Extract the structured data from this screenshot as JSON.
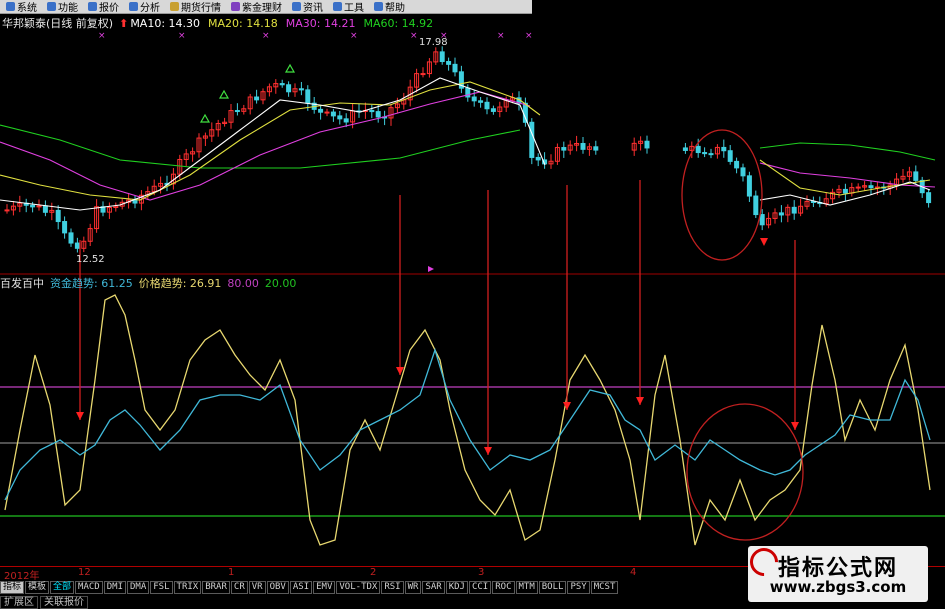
{
  "menu": {
    "items": [
      {
        "label": "系统",
        "color": "#3a70c8"
      },
      {
        "label": "功能",
        "color": "#3a70c8"
      },
      {
        "label": "报价",
        "color": "#3a70c8"
      },
      {
        "label": "分析",
        "color": "#3a70c8"
      },
      {
        "label": "期货行情",
        "color": "#c8a030"
      },
      {
        "label": "紫金理财",
        "color": "#8040c0"
      },
      {
        "label": "资讯",
        "color": "#3a70c8"
      },
      {
        "label": "工具",
        "color": "#3a70c8"
      },
      {
        "label": "帮助",
        "color": "#3a70c8"
      }
    ]
  },
  "header": {
    "stock": "华邦颖泰(日线 前复权)",
    "ma10": "MA10: 14.30",
    "ma20": "MA20: 14.18",
    "ma30": "MA30: 14.21",
    "ma60": "MA60: 14.92",
    "colors": {
      "ma10": "#ffffff",
      "ma20": "#e0e040",
      "ma30": "#e040e0",
      "ma60": "#20d020"
    }
  },
  "price_panel": {
    "high_label": "17.98",
    "low_label": "12.52"
  },
  "indicator": {
    "name": "百发百中",
    "fund_trend": "资金趋势: 61.25",
    "price_trend": "价格趋势: 26.91",
    "level80": "80.00",
    "level20": "20.00",
    "colors": {
      "fund": "#40b8d8",
      "price": "#e8d870",
      "level80": "#c040c0",
      "level20": "#20c020"
    }
  },
  "time_axis": {
    "labels": [
      "2012年",
      "12",
      "1",
      "2",
      "3",
      "4"
    ]
  },
  "indicator_tabs": [
    "指标",
    "模板",
    "全部",
    "MACD",
    "DMI",
    "DMA",
    "FSL",
    "TRIX",
    "BRAR",
    "CR",
    "VR",
    "OBV",
    "ASI",
    "EMV",
    "VOL-TDX",
    "RSI",
    "WR",
    "SAR",
    "KDJ",
    "CCI",
    "ROC",
    "MTM",
    "BOLL",
    "PSY",
    "MCST"
  ],
  "bottom_tabs": [
    "扩展区",
    "关联报价"
  ],
  "watermark": {
    "line1": "指标公式网",
    "line2": "www.zbgs3.com"
  }
}
